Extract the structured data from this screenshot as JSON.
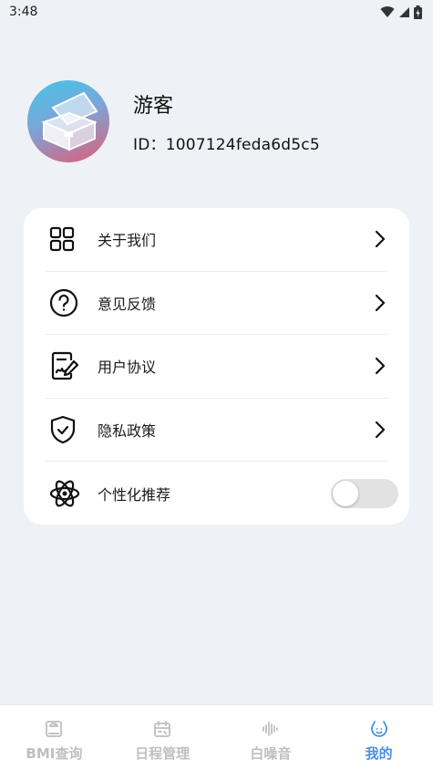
{
  "status_bar": {
    "time": "3:48"
  },
  "profile": {
    "username": "游客",
    "user_id": "ID：1007124feda6d5c5"
  },
  "menu": {
    "items": [
      {
        "label": "关于我们",
        "icon": "grid-icon"
      },
      {
        "label": "意见反馈",
        "icon": "question-circle-icon"
      },
      {
        "label": "用户协议",
        "icon": "document-edit-icon"
      },
      {
        "label": "隐私政策",
        "icon": "shield-check-icon"
      },
      {
        "label": "个性化推荐",
        "icon": "atom-icon",
        "toggle_on": false
      }
    ]
  },
  "tab_bar": {
    "tabs": [
      {
        "label": "BMI查询",
        "icon": "scale-icon",
        "active": false
      },
      {
        "label": "日程管理",
        "icon": "calendar-icon",
        "active": false
      },
      {
        "label": "白噪音",
        "icon": "sound-wave-icon",
        "active": false
      },
      {
        "label": "我的",
        "icon": "smile-icon",
        "active": true
      }
    ]
  },
  "colors": {
    "background": "#eef1f5",
    "card": "#ffffff",
    "accent": "#4a8fe8",
    "inactive_tab": "#bfbfbf",
    "toggle_off": "#e2e2e2"
  }
}
